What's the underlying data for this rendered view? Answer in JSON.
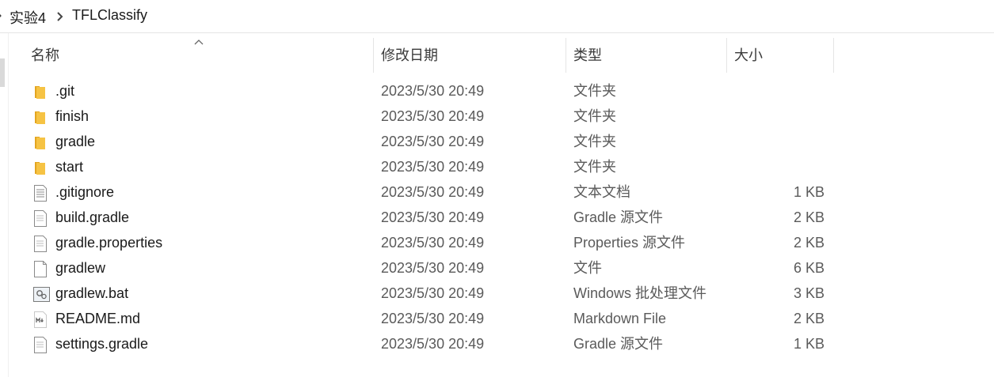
{
  "breadcrumb": {
    "lead": "›",
    "items": [
      "实验4",
      "TFLClassify"
    ]
  },
  "columns": {
    "name": "名称",
    "date": "修改日期",
    "type": "类型",
    "size": "大小"
  },
  "files": [
    {
      "icon": "folder-icon",
      "name": ".git",
      "date": "2023/5/30 20:49",
      "type": "文件夹",
      "size": ""
    },
    {
      "icon": "folder-icon",
      "name": "finish",
      "date": "2023/5/30 20:49",
      "type": "文件夹",
      "size": ""
    },
    {
      "icon": "folder-icon",
      "name": "gradle",
      "date": "2023/5/30 20:49",
      "type": "文件夹",
      "size": ""
    },
    {
      "icon": "folder-icon",
      "name": "start",
      "date": "2023/5/30 20:49",
      "type": "文件夹",
      "size": ""
    },
    {
      "icon": "text-document-icon",
      "name": ".gitignore",
      "date": "2023/5/30 20:49",
      "type": "文本文档",
      "size": "1 KB"
    },
    {
      "icon": "source-file-icon",
      "name": "build.gradle",
      "date": "2023/5/30 20:49",
      "type": "Gradle 源文件",
      "size": "2 KB"
    },
    {
      "icon": "source-file-icon",
      "name": "gradle.properties",
      "date": "2023/5/30 20:49",
      "type": "Properties 源文件",
      "size": "2 KB"
    },
    {
      "icon": "blank-file-icon",
      "name": "gradlew",
      "date": "2023/5/30 20:49",
      "type": "文件",
      "size": "6 KB"
    },
    {
      "icon": "batch-file-icon",
      "name": "gradlew.bat",
      "date": "2023/5/30 20:49",
      "type": "Windows 批处理文件",
      "size": "3 KB"
    },
    {
      "icon": "markdown-file-icon",
      "name": "README.md",
      "date": "2023/5/30 20:49",
      "type": "Markdown File",
      "size": "2 KB"
    },
    {
      "icon": "source-file-icon",
      "name": "settings.gradle",
      "date": "2023/5/30 20:49",
      "type": "Gradle 源文件",
      "size": "1 KB"
    }
  ],
  "colors": {
    "folder": "#f6c344",
    "folder_dark": "#e3a520",
    "header_text": "#3a3a3a",
    "secondary_text": "#5a5a5a",
    "divider": "#e5e5e5"
  }
}
